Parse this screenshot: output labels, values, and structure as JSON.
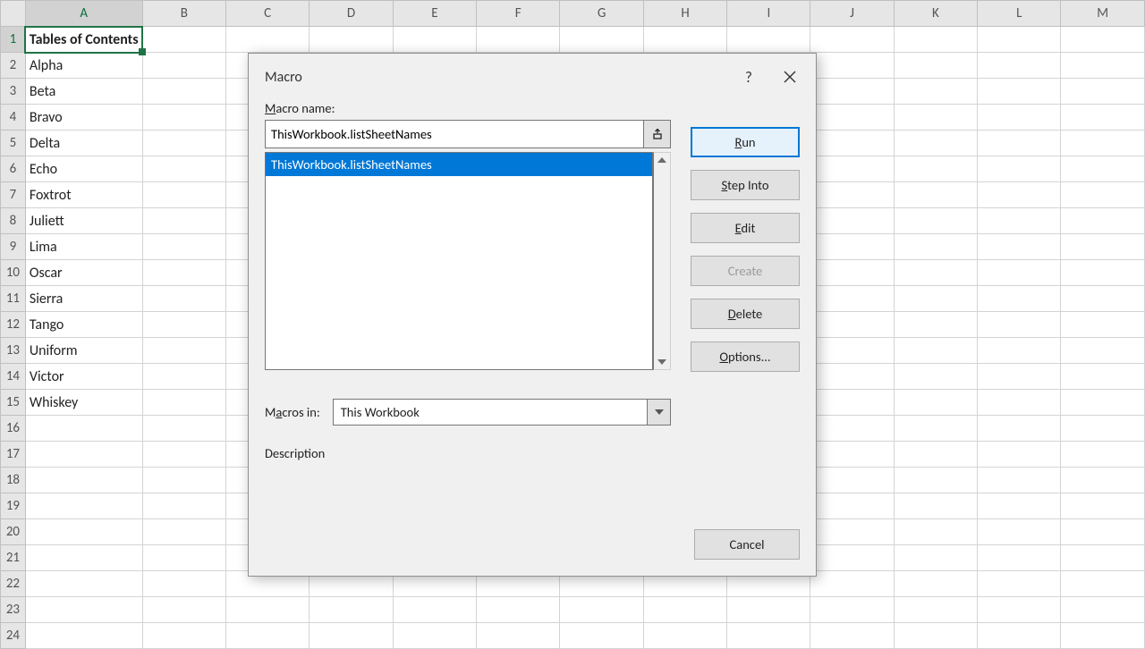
{
  "columns": [
    "A",
    "B",
    "C",
    "D",
    "E",
    "F",
    "G",
    "H",
    "I",
    "J",
    "K",
    "L",
    "M"
  ],
  "rows": [
    {
      "n": 1,
      "A": "Tables of Contents",
      "bold": true,
      "selected": true
    },
    {
      "n": 2,
      "A": "Alpha"
    },
    {
      "n": 3,
      "A": "Beta"
    },
    {
      "n": 4,
      "A": "Bravo"
    },
    {
      "n": 5,
      "A": "Delta"
    },
    {
      "n": 6,
      "A": "Echo"
    },
    {
      "n": 7,
      "A": "Foxtrot"
    },
    {
      "n": 8,
      "A": "Juliett"
    },
    {
      "n": 9,
      "A": "Lima"
    },
    {
      "n": 10,
      "A": "Oscar"
    },
    {
      "n": 11,
      "A": "Sierra"
    },
    {
      "n": 12,
      "A": "Tango"
    },
    {
      "n": 13,
      "A": "Uniform"
    },
    {
      "n": 14,
      "A": "Victor"
    },
    {
      "n": 15,
      "A": "Whiskey"
    },
    {
      "n": 16,
      "A": ""
    },
    {
      "n": 17,
      "A": ""
    },
    {
      "n": 18,
      "A": ""
    },
    {
      "n": 19,
      "A": ""
    },
    {
      "n": 20,
      "A": ""
    },
    {
      "n": 21,
      "A": ""
    },
    {
      "n": 22,
      "A": ""
    },
    {
      "n": 23,
      "A": ""
    },
    {
      "n": 24,
      "A": ""
    }
  ],
  "dialog": {
    "title": "Macro",
    "macro_name_label": "Macro name:",
    "macro_name_value": "ThisWorkbook.listSheetNames",
    "list_items": [
      "ThisWorkbook.listSheetNames"
    ],
    "macros_in_label": "Macros in:",
    "macros_in_value": "This Workbook",
    "description_label": "Description",
    "buttons": {
      "run": "Run",
      "step_into": "Step Into",
      "edit": "Edit",
      "create": "Create",
      "delete": "Delete",
      "options": "Options...",
      "cancel": "Cancel"
    },
    "help_tooltip": "?"
  }
}
